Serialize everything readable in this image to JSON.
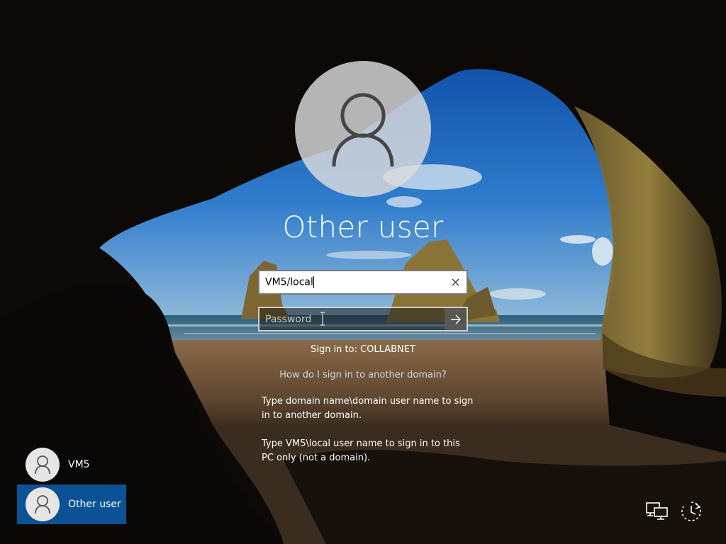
{
  "login": {
    "user_title": "Other user",
    "username_value": "VM5/local",
    "password_placeholder": "Password",
    "sign_in_to": "Sign in to: COLLABNET",
    "help_link": "How do I sign in to another domain?",
    "help_text_1": "Type domain name\\domain user name to sign in to another domain.",
    "help_text_2": "Type VM5\\local user name to sign in to this PC only (not a domain)."
  },
  "users": [
    {
      "label": "VM5",
      "selected": false
    },
    {
      "label": "Other user",
      "selected": true
    }
  ],
  "icons": {
    "avatar": "person-icon",
    "clear": "close-icon",
    "submit": "arrow-right-icon",
    "network": "network-icon",
    "power": "power-icon"
  },
  "colors": {
    "selected_tile": "#0a5294"
  }
}
